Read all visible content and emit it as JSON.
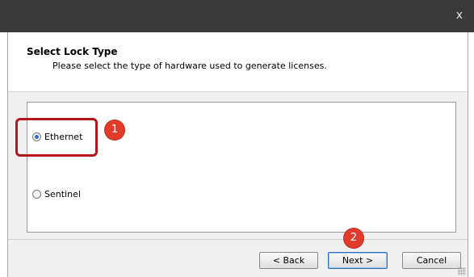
{
  "window": {
    "close_glyph": "x"
  },
  "header": {
    "title": "Select Lock Type",
    "subtitle": "Please select the type of hardware used to generate licenses."
  },
  "options": [
    {
      "label": "Ethernet",
      "selected": true
    },
    {
      "label": "Sentinel",
      "selected": false
    }
  ],
  "annotations": {
    "step1": "1",
    "step2": "2",
    "highlight_color": "#b3171b",
    "badge_color": "#e23b2b"
  },
  "buttons": {
    "back": "< Back",
    "next": "Next >",
    "cancel": "Cancel"
  }
}
